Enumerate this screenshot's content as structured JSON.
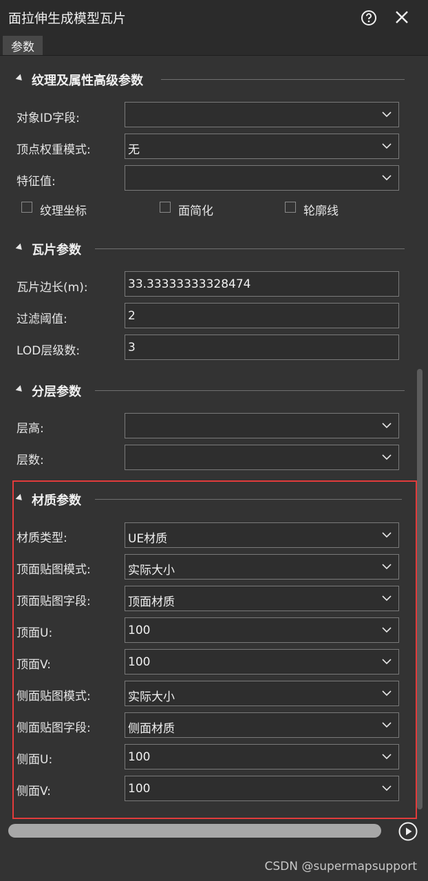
{
  "window": {
    "title": "面拉伸生成模型瓦片",
    "help_icon": "help-circle-icon",
    "close_icon": "close-icon"
  },
  "tabs": [
    {
      "label": "参数"
    }
  ],
  "sections": {
    "texture": {
      "title": "纹理及属性高级参数",
      "rows": [
        {
          "label": "对象ID字段:",
          "value": ""
        },
        {
          "label": "顶点权重模式:",
          "value": "无"
        },
        {
          "label": "特征值:",
          "value": ""
        }
      ],
      "checkboxes": [
        {
          "label": "纹理坐标",
          "checked": false
        },
        {
          "label": "面简化",
          "checked": false
        },
        {
          "label": "轮廓线",
          "checked": false
        }
      ]
    },
    "tile": {
      "title": "瓦片参数",
      "rows": [
        {
          "label": "瓦片边长(m):",
          "value": "33.33333333328474"
        },
        {
          "label": "过滤阈值:",
          "value": "2"
        },
        {
          "label": "LOD层级数:",
          "value": "3"
        }
      ]
    },
    "layer": {
      "title": "分层参数",
      "rows": [
        {
          "label": "层高:",
          "value": ""
        },
        {
          "label": "层数:",
          "value": ""
        }
      ]
    },
    "material": {
      "title": "材质参数",
      "rows": [
        {
          "label": "材质类型:",
          "value": "UE材质"
        },
        {
          "label": "顶面贴图模式:",
          "value": "实际大小"
        },
        {
          "label": "顶面贴图字段:",
          "value": "顶面材质"
        },
        {
          "label": "顶面U:",
          "value": "100"
        },
        {
          "label": "顶面V:",
          "value": "100"
        },
        {
          "label": "侧面贴图模式:",
          "value": "实际大小"
        },
        {
          "label": "侧面贴图字段:",
          "value": "侧面材质"
        },
        {
          "label": "侧面U:",
          "value": "100"
        },
        {
          "label": "侧面V:",
          "value": "100"
        }
      ]
    }
  },
  "footer": {
    "play_icon": "play-icon",
    "watermark": "CSDN @supermapsupport"
  },
  "colors": {
    "background": "#333333",
    "titlebar": "#2b2b2b",
    "highlight_border": "#e23b3b"
  }
}
